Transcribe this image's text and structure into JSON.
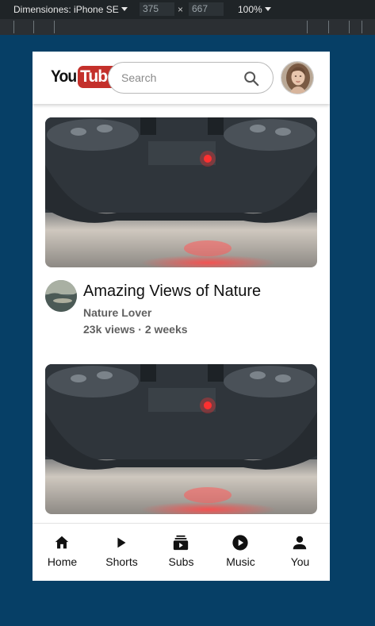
{
  "devtools": {
    "device_label": "Dimensiones: iPhone SE",
    "width": "375",
    "height": "667",
    "separator": "×",
    "zoom": "100%"
  },
  "header": {
    "logo_you": "You",
    "logo_tube": "Tube",
    "search_placeholder": "Search"
  },
  "videos": [
    {
      "title": "Amazing Views of Nature",
      "channel": "Nature Lover",
      "stats": "23k views · 2 weeks"
    },
    {
      "title": "",
      "channel": "",
      "stats": ""
    }
  ],
  "nav": [
    {
      "label": "Home",
      "icon": "home-icon"
    },
    {
      "label": "Shorts",
      "icon": "play-icon"
    },
    {
      "label": "Subs",
      "icon": "subscriptions-icon"
    },
    {
      "label": "Music",
      "icon": "play-circle-icon"
    },
    {
      "label": "You",
      "icon": "person-icon"
    }
  ],
  "colors": {
    "page_background": "#063f66",
    "logo_red": "#c4302b"
  }
}
